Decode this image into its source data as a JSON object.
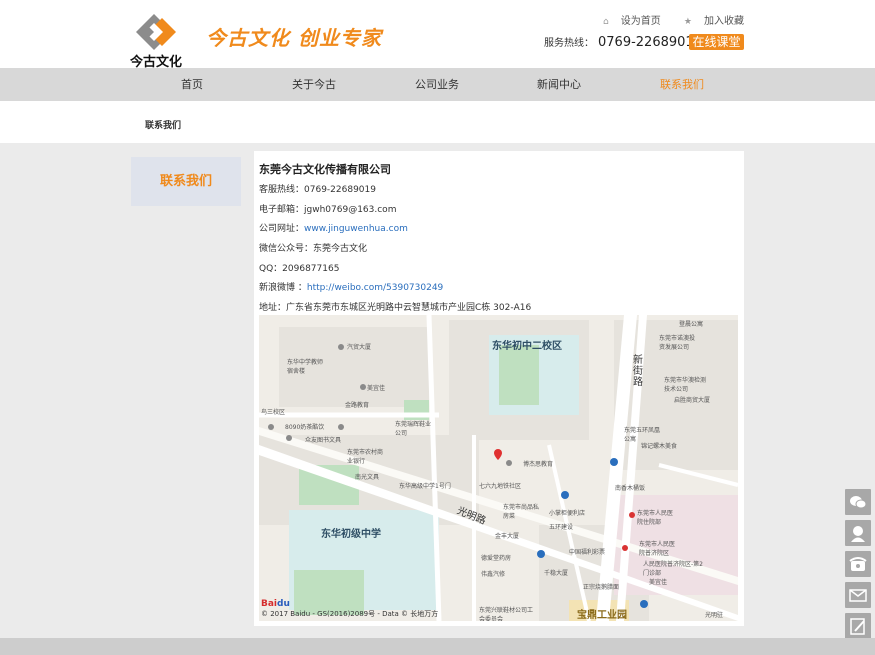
{
  "header": {
    "logo_text": "今古文化",
    "slogan": "今古文化 创业专家",
    "top_links": [
      "设为首页",
      "加入收藏"
    ],
    "hotline_label": "服务热线：",
    "hotline_number": "0769-22689019",
    "online_button": "在线课堂"
  },
  "nav": {
    "items": [
      "首页",
      "关于今古",
      "公司业务",
      "新闻中心",
      "联系我们"
    ],
    "active": "联系我们"
  },
  "breadcrumb": "联系我们",
  "sidebar": {
    "title": "联系我们"
  },
  "contact": {
    "company": "东莞今古文化传播有限公司",
    "hotline_label": "客服热线：",
    "hotline": "0769-22689019",
    "email_label": "电子邮箱：",
    "email": "jgwh0769@163.com",
    "website_label": "公司网址：",
    "website": "www.jinguwenhua.com",
    "wechat_label": "微信公众号：",
    "wechat": "东莞今古文化",
    "qq_label": "QQ：",
    "qq": "2096877165",
    "weibo_label": "新浪微博 ：",
    "weibo": "http://weibo.com/5390730249",
    "address_label": "地址：",
    "address": "广东省东莞市东城区光明路中云智慧城市产业园C栋 302-A16"
  },
  "map": {
    "labels": {
      "school2": "东华初中二校区",
      "school_mid": "东华初级中学",
      "road_guangming": "光明路",
      "road_xinjie": "新街路",
      "industrial": "宝鼎工业园",
      "pois": [
        "汽贸大厦",
        "东华中学教师宿舍楼",
        "美宜佳",
        "金路教育",
        "鸟三校区",
        "8090奶茶酷饮",
        "众友图书文具",
        "东莞瑞辉鞋业公司",
        "东莞市农村商业银行",
        "南光文具",
        "东华高级中学1号门",
        "七六九地铁社区",
        "博杰思教育",
        "东莞市尚品私房菜",
        "小掌柜便利店",
        "五环建设",
        "金丰大厦",
        "德爱堂药房",
        "中国福利彩票",
        "千稳大厦",
        "伟鑫汽修",
        "正宗烧鹅腊面",
        "美宜佳",
        "东莞兴联鞋材公司工会委员会",
        "光明驻",
        "登晨公寓",
        "东莞市诺澳投资发展公司",
        "东莞市华澳检测技术公司",
        "启胜商贸大厦",
        "东莞五环凤凰公寓",
        "锦记螺木美食",
        "南香木桶饭",
        "东莞市人民医院住院部",
        "东莞市人民医院普济院区",
        "人民医院普济院区-第2门诊部"
      ],
      "copyright": "© 2017 Baidu - GS(2016)2089号 - Data © 长地万方",
      "baidu_logo": "Bai",
      "baidu_logo_b": "du"
    }
  },
  "floatbar": [
    "wechat-icon",
    "customer-service-icon",
    "phone-icon",
    "mail-icon",
    "feedback-icon"
  ],
  "colors": {
    "accent": "#f08a1c",
    "nav_bg": "#d8d8d8",
    "link": "#2a6ebd"
  }
}
